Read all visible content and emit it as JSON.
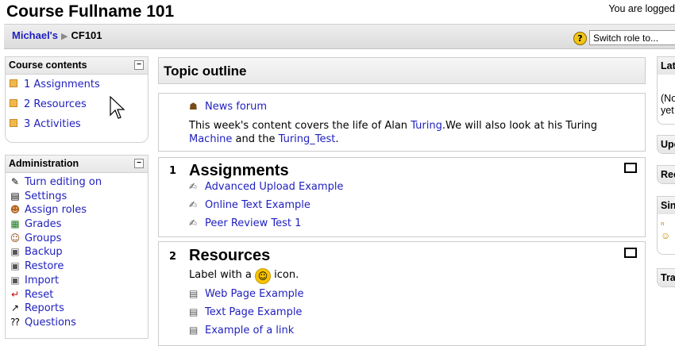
{
  "header": {
    "course_title": "Course Fullname 101",
    "logged_in_text": "You are logged"
  },
  "navbar": {
    "breadcrumb": [
      {
        "label": "Michael's"
      },
      {
        "label": "CF101"
      }
    ],
    "switch_role_label": "Switch role to...",
    "help_icon": "?"
  },
  "course_contents": {
    "title": "Course contents",
    "items": [
      "1 Assignments",
      "2 Resources",
      "3 Activities"
    ]
  },
  "administration": {
    "title": "Administration",
    "items": [
      {
        "label": "Turn editing on",
        "icon": "pencil-icon",
        "glyph": "✎"
      },
      {
        "label": "Settings",
        "icon": "settings-icon",
        "glyph": "▤"
      },
      {
        "label": "Assign roles",
        "icon": "roles-icon",
        "glyph": "☻"
      },
      {
        "label": "Grades",
        "icon": "grades-icon",
        "glyph": "▦"
      },
      {
        "label": "Groups",
        "icon": "groups-icon",
        "glyph": "☺"
      },
      {
        "label": "Backup",
        "icon": "backup-icon",
        "glyph": "▣"
      },
      {
        "label": "Restore",
        "icon": "restore-icon",
        "glyph": "▣"
      },
      {
        "label": "Import",
        "icon": "import-icon",
        "glyph": "▣"
      },
      {
        "label": "Reset",
        "icon": "reset-icon",
        "glyph": "↵"
      },
      {
        "label": "Reports",
        "icon": "reports-icon",
        "glyph": "↗"
      },
      {
        "label": "Questions",
        "icon": "questions-icon",
        "glyph": "⁇"
      }
    ]
  },
  "main": {
    "topic_outline_title": "Topic outline",
    "intro": {
      "forum_link": "News forum",
      "text_1": "This week's content covers the life of Alan ",
      "link_turing": "Turing",
      "text_2": ".We will also look at his Turing",
      "link_machine": "Machine",
      "text_3": " and the ",
      "link_turing_test": "Turing_Test",
      "text_4": "."
    },
    "sections": [
      {
        "number": "1",
        "title": "Assignments",
        "items": [
          "Advanced Upload Example",
          "Online Text Example",
          "Peer Review Test 1"
        ]
      },
      {
        "number": "2",
        "title": "Resources",
        "label_text_before": "Label with a ",
        "label_text_after": " icon.",
        "items": [
          "Web Page Example",
          "Text Page Example",
          "Example of a link"
        ]
      }
    ]
  },
  "right_blocks": [
    {
      "title": "Lat",
      "lines": [
        "(No",
        "yet"
      ]
    },
    {
      "title": "Upc",
      "lines": []
    },
    {
      "title": "Rec",
      "lines": []
    },
    {
      "title": "Sin",
      "lines": []
    },
    {
      "title": "Tra",
      "lines": []
    }
  ]
}
